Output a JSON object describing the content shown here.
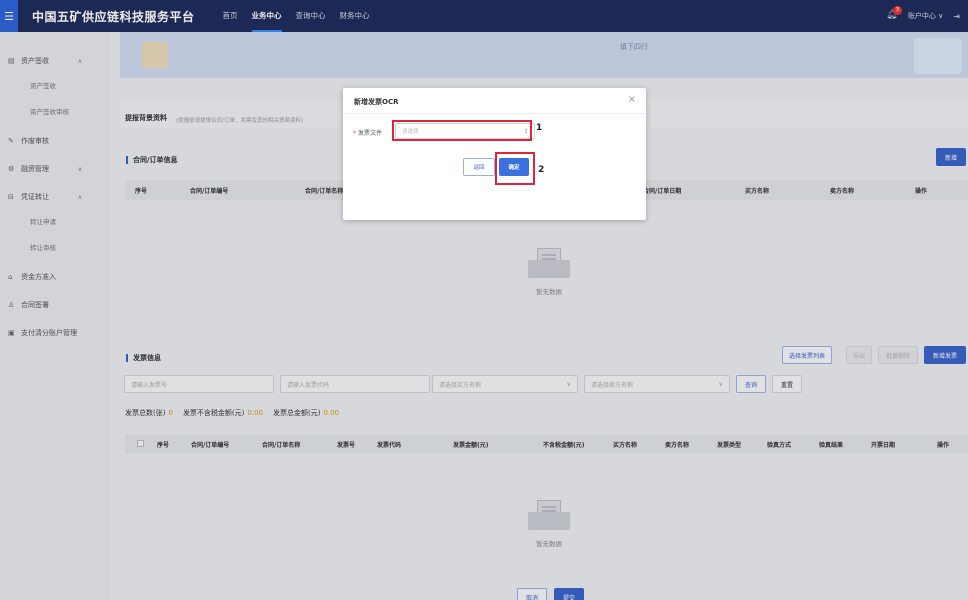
{
  "header": {
    "brand": "中国五矿供应链科技服务平台",
    "nav": [
      "首页",
      "业务中心",
      "查询中心",
      "财务中心"
    ],
    "active_nav_index": 1,
    "notification_count": "3",
    "account_label": "账户中心",
    "account_chevron": "∨",
    "exit_glyph": "⇥"
  },
  "sidebar": {
    "groups": [
      {
        "label": "资产签收",
        "subs": [
          "资产签收",
          "资产签收审核"
        ]
      },
      {
        "label": "作废审核"
      },
      {
        "label": "融资管理"
      },
      {
        "label": "凭证转让",
        "subs": [
          "转让申请",
          "转让审核"
        ]
      },
      {
        "label": "资金方准入"
      },
      {
        "label": "合同签署"
      },
      {
        "label": "支付清分账户管理"
      }
    ]
  },
  "banner": {
    "text": "填下四行"
  },
  "trade_section": {
    "title": "提报背景资料",
    "hint": "(提报前请提报合同/订单、发票及其他相关贸易资料)"
  },
  "contract_section": {
    "title": "合同/订单信息",
    "new_button": "新增",
    "columns": [
      "序号",
      "合同/订单编号",
      "合同/订单名称",
      "合同/订单日期",
      "买方名称",
      "卖方名称",
      "操作"
    ],
    "empty_text": "暂无数据"
  },
  "invoice_section": {
    "title": "发票信息",
    "buttons": {
      "pick_list": "选择发票列表",
      "b2": "导出",
      "b3": "批量删除",
      "new_invoice": "新增发票"
    },
    "filters": {
      "invoice_no": "请输入发票号",
      "invoice_code": "请输入发票代码",
      "buyer": "请选择买方名称",
      "seller": "请选择卖方名称"
    },
    "query": "查询",
    "reset": "重置",
    "stats": [
      {
        "label": "发票总数(张)",
        "value": "0"
      },
      {
        "label": "发票不含税金额(元)",
        "value": "0.00"
      },
      {
        "label": "发票总金额(元)",
        "value": "0.00"
      }
    ],
    "columns": [
      "序号",
      "合同/订单编号",
      "合同/订单名称",
      "发票号",
      "发票代码",
      "发票金额(元)",
      "不含税金额(元)",
      "买方名称",
      "卖方名称",
      "发票类型",
      "验真方式",
      "验真结果",
      "开票日期",
      "操作"
    ],
    "empty_text": "暂无数据"
  },
  "bottom_buttons": {
    "cancel": "取消",
    "submit": "提交"
  },
  "modal": {
    "title": "新增发票OCR",
    "close_glyph": "×",
    "field_label": "发票文件",
    "required_mark": "*",
    "file_placeholder": "请选择",
    "upload_glyph": "⇪",
    "return_label": "返回",
    "confirm_label": "确定",
    "annotation_1": "1",
    "annotation_2": "2"
  },
  "colors": {
    "header_bg": "#1f2d5c",
    "primary": "#3a63c9",
    "annotation_red": "#e0223a",
    "stat_value": "#d89a12"
  }
}
